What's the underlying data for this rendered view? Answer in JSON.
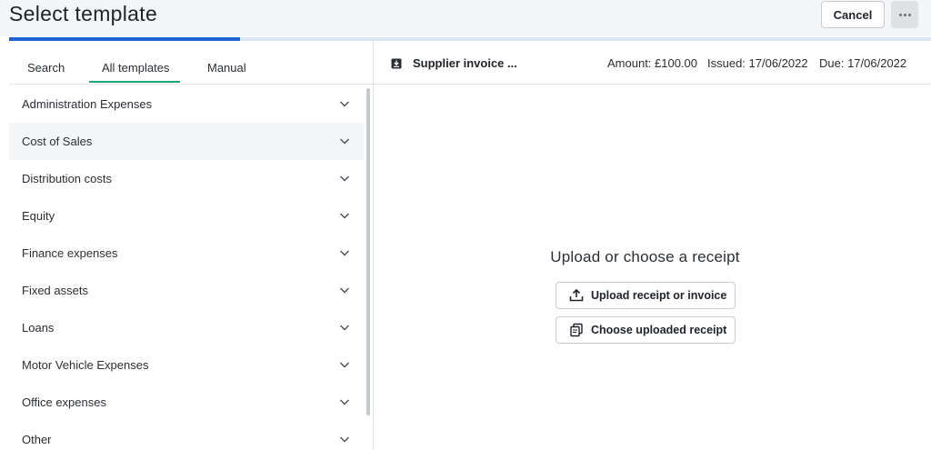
{
  "header": {
    "title": "Select template",
    "cancel_label": "Cancel",
    "more_icon": "more-horizontal-icon"
  },
  "progress": {
    "fraction": 0.25,
    "color": "#1e63cf"
  },
  "tabs": [
    {
      "label": "Search",
      "active": false
    },
    {
      "label": "All templates",
      "active": true
    },
    {
      "label": "Manual",
      "active": false
    }
  ],
  "categories": [
    {
      "label": "Administration Expenses"
    },
    {
      "label": "Cost of Sales",
      "hover": true
    },
    {
      "label": "Distribution costs"
    },
    {
      "label": "Equity"
    },
    {
      "label": "Finance expenses"
    },
    {
      "label": "Fixed assets"
    },
    {
      "label": "Loans"
    },
    {
      "label": "Motor Vehicle Expenses"
    },
    {
      "label": "Office expenses"
    },
    {
      "label": "Other"
    }
  ],
  "document": {
    "name": "Supplier invoice ...",
    "amount": "Amount: £100.00",
    "issued": "Issued: 17/06/2022",
    "due": "Due: 17/06/2022"
  },
  "upload": {
    "heading": "Upload or choose a receipt",
    "upload_button": "Upload receipt or invoice",
    "choose_button": "Choose uploaded receipt"
  },
  "colors": {
    "accent_blue": "#1e63cf",
    "tab_underline": "#1ea37a"
  }
}
